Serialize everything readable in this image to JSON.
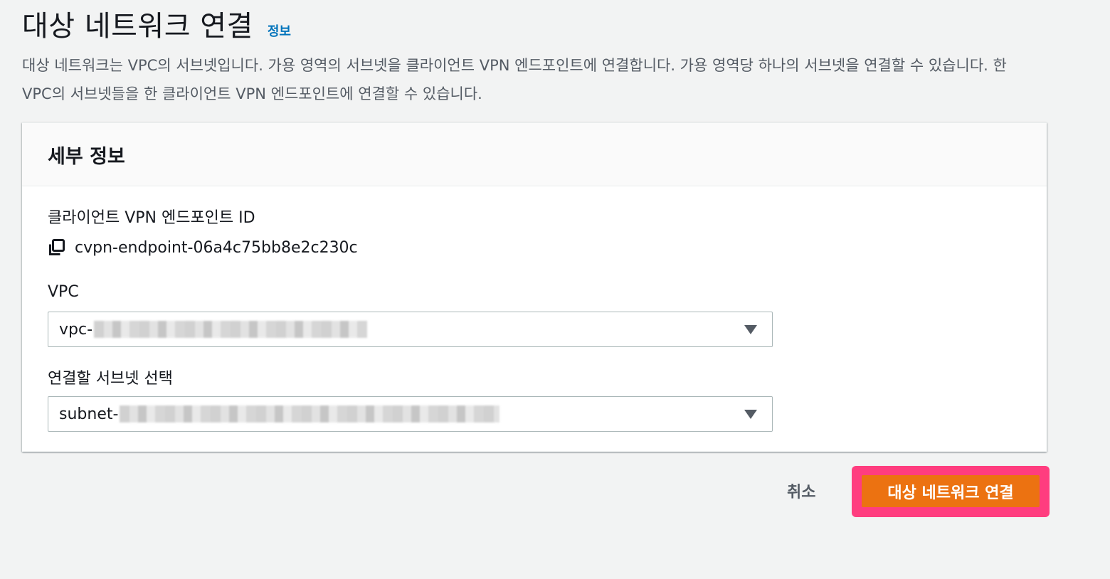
{
  "header": {
    "title": "대상 네트워크 연결",
    "info_link": "정보"
  },
  "description": "대상 네트워크는 VPC의 서브넷입니다. 가용 영역의 서브넷을 클라이언트 VPN 엔드포인트에 연결합니다. 가용 영역당 하나의 서브넷을 연결할 수 있습니다. 한 VPC의 서브넷들을 한 클라이언트 VPN 엔드포인트에 연결할 수 있습니다.",
  "details": {
    "title": "세부 정보",
    "endpoint_label": "클라이언트 VPN 엔드포인트 ID",
    "endpoint_value": "cvpn-endpoint-06a4c75bb8e2c230c",
    "vpc_label": "VPC",
    "vpc_value": "vpc-",
    "subnet_label": "연결할 서브넷 선택",
    "subnet_value": "subnet-"
  },
  "actions": {
    "cancel": "취소",
    "submit": "대상 네트워크 연결",
    "submit_highlight_color": "#ff3d7f",
    "submit_color": "#ec7211"
  }
}
